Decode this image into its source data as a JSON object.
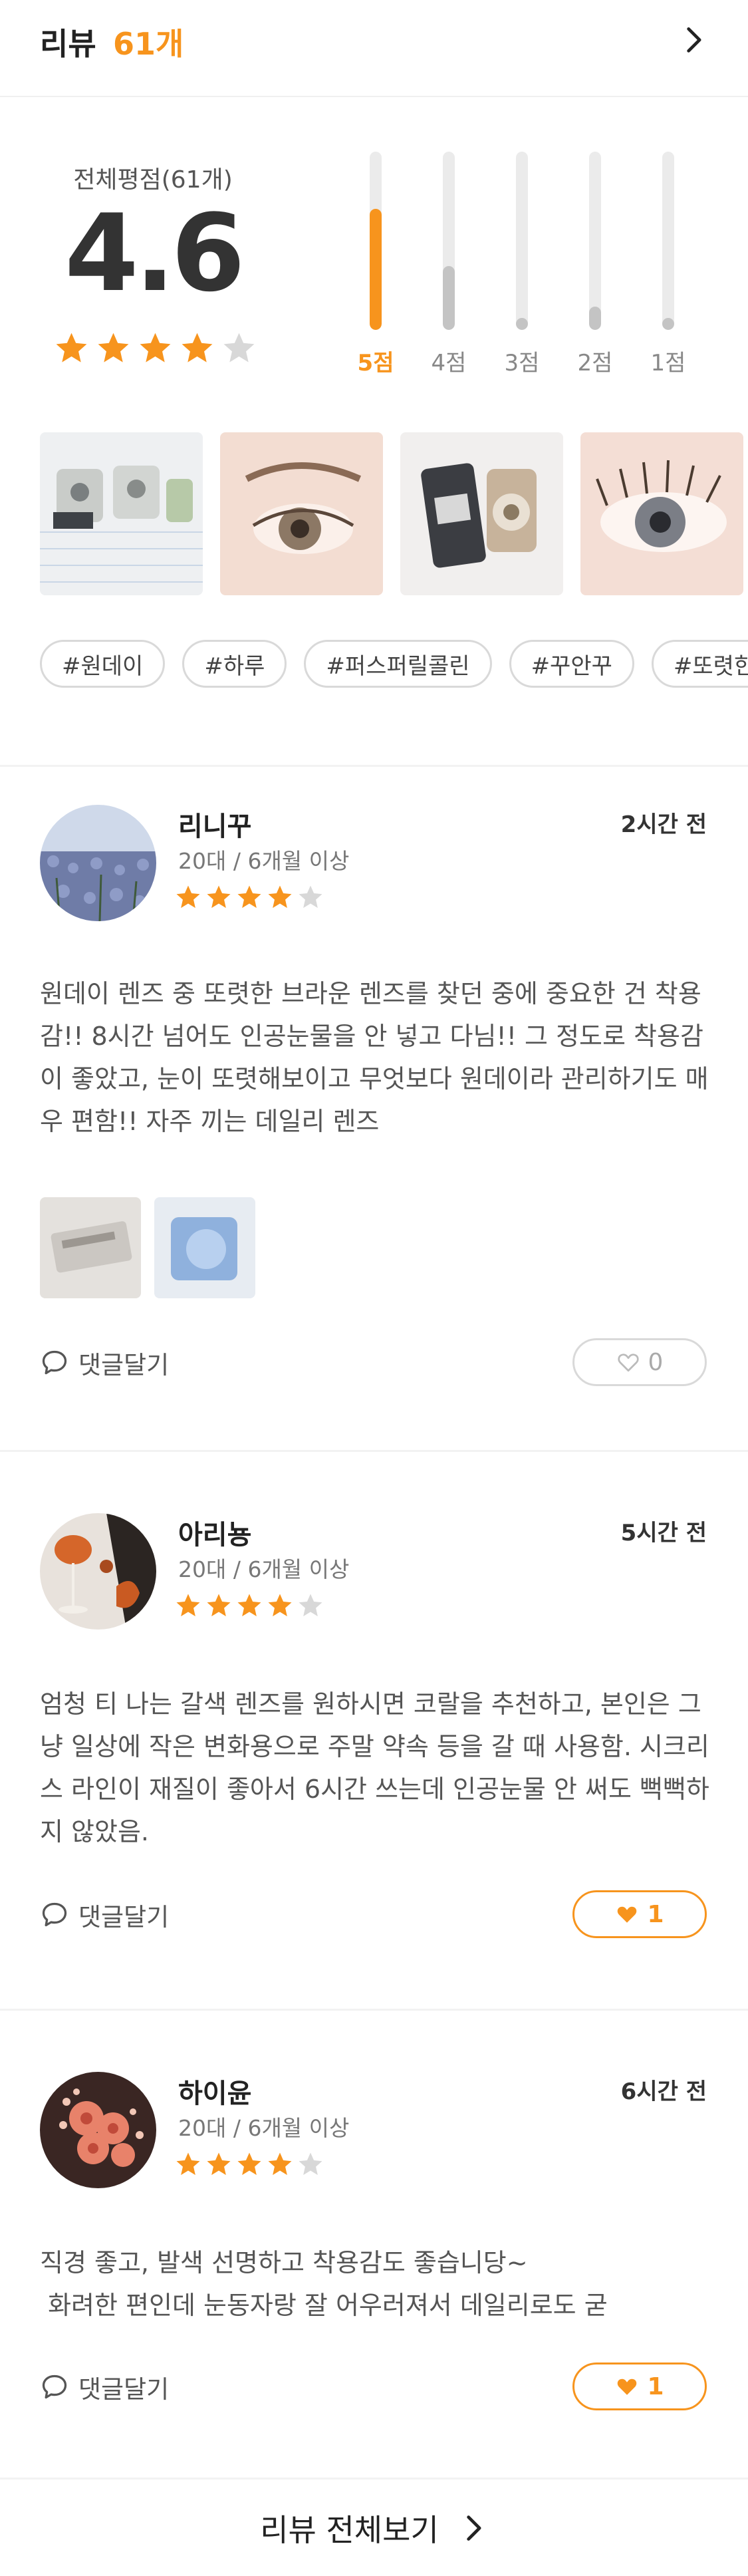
{
  "header": {
    "title": "리뷰",
    "count": "61개"
  },
  "summary": {
    "avg_label": "전체평점(61개)",
    "avg_value": "4.6",
    "avg_rating": 4,
    "distribution": [
      {
        "label": "5점",
        "fraction": 0.68,
        "active": true
      },
      {
        "label": "4점",
        "fraction": 0.36,
        "active": false
      },
      {
        "label": "3점",
        "fraction": 0.05,
        "active": false
      },
      {
        "label": "2점",
        "fraction": 0.13,
        "active": false
      },
      {
        "label": "1점",
        "fraction": 0.05,
        "active": false
      }
    ]
  },
  "tags": [
    "#원데이",
    "#하루",
    "#퍼스퍼릴콜린",
    "#꾸안꾸",
    "#또렷한"
  ],
  "reviews": [
    {
      "name": "리니꾸",
      "meta": "20대  /  6개월 이상",
      "rating": 4,
      "time": "2시간 전",
      "text": "원데이 렌즈 중 또렷한 브라운 렌즈를 찾던 중에 중요한 건 착용감!! 8시간 넘어도 인공눈물을 안 넣고 다님!! 그 정도로 착용감이 좋았고, 눈이 또렷해보이고 무엇보다 원데이라 관리하기도 매우 편함!! 자주 끼는 데일리 렌즈",
      "comment_label": "댓글달기",
      "likes": "0",
      "liked": false
    },
    {
      "name": "아리뇽",
      "meta": "20대  /  6개월 이상",
      "rating": 4,
      "time": "5시간 전",
      "text": "엄청 티 나는 갈색 렌즈를 원하시면 코랄을 추천하고, 본인은 그냥 일상에 작은 변화용으로 주말 약속 등을 갈 때 사용함. 시크리스 라인이 재질이 좋아서 6시간 쓰는데 인공눈물 안 써도 뻑뻑하지 않았음.",
      "comment_label": "댓글달기",
      "likes": "1",
      "liked": true
    },
    {
      "name": "하이윤",
      "meta": "20대  /  6개월 이상",
      "rating": 4,
      "time": "6시간 전",
      "text_line1": "직경 좋고, 발색 선명하고 착용감도 좋습니당~",
      "text_line2": " 화려한 편인데 눈동자랑 잘 어우러져서 데일리로도 굳",
      "comment_label": "댓글달기",
      "likes": "1",
      "liked": true
    }
  ],
  "footer": {
    "label": "리뷰 전체보기"
  },
  "colors": {
    "accent": "#f7941d",
    "star_empty": "#d8d8d8",
    "bar_inactive": "#c4c4c4"
  }
}
